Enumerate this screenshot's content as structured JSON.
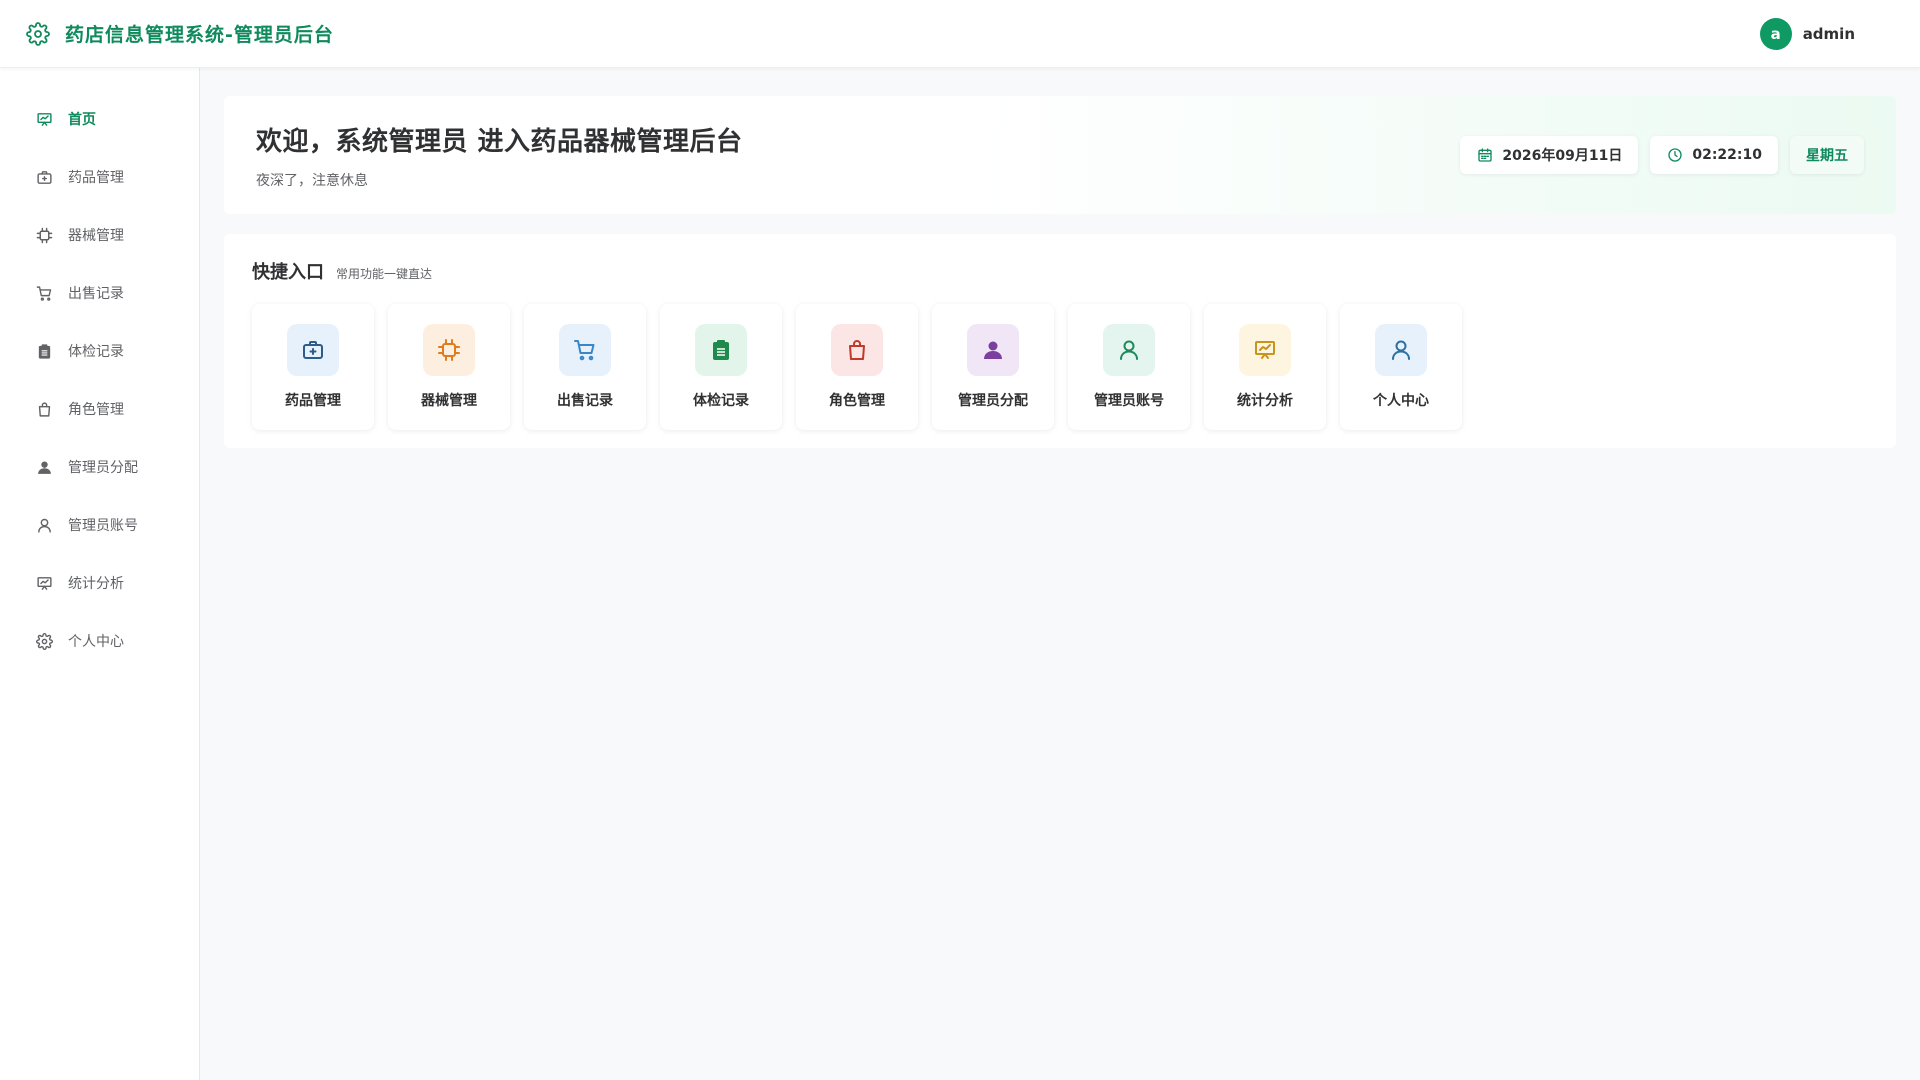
{
  "header": {
    "app_title": "药店信息管理系统-管理员后台",
    "user": {
      "avatar_letter": "a",
      "name": "admin"
    },
    "brand_color": "#0f8a5c"
  },
  "sidebar": {
    "items": [
      {
        "label": "首页",
        "icon": "presentation-chart-icon",
        "active": true
      },
      {
        "label": "药品管理",
        "icon": "medical-kit-icon"
      },
      {
        "label": "器械管理",
        "icon": "chip-icon"
      },
      {
        "label": "出售记录",
        "icon": "shopping-cart-icon"
      },
      {
        "label": "体检记录",
        "icon": "clipboard-icon"
      },
      {
        "label": "角色管理",
        "icon": "shopping-bag-icon"
      },
      {
        "label": "管理员分配",
        "icon": "user-filled-icon"
      },
      {
        "label": "管理员账号",
        "icon": "user-outline-icon"
      },
      {
        "label": "统计分析",
        "icon": "presentation-chart-icon"
      },
      {
        "label": "个人中心",
        "icon": "gear-icon"
      }
    ]
  },
  "banner": {
    "title": "欢迎，系统管理员 进入药品器械管理后台",
    "subtitle": "夜深了，注意休息",
    "date": "2026年09月11日",
    "time": "02:22:10",
    "weekday": "星期五"
  },
  "quick_access": {
    "title": "快捷入口",
    "subtitle": "常用功能一键直达",
    "cards": [
      {
        "label": "药品管理",
        "icon": "medical-kit-icon",
        "color": "#2d5b8a",
        "bg": "#e6f1fb"
      },
      {
        "label": "器械管理",
        "icon": "chip-icon",
        "color": "#e07b1e",
        "bg": "#fdefe0"
      },
      {
        "label": "出售记录",
        "icon": "shopping-cart-icon",
        "color": "#3a87c8",
        "bg": "#e6f1fb"
      },
      {
        "label": "体检记录",
        "icon": "clipboard-icon",
        "color": "#1e8a4c",
        "bg": "#e3f5ea"
      },
      {
        "label": "角色管理",
        "icon": "shopping-bag-icon",
        "color": "#c0392b",
        "bg": "#fbe5e5"
      },
      {
        "label": "管理员分配",
        "icon": "user-filled-icon",
        "color": "#7b3fa0",
        "bg": "#f0e6f5"
      },
      {
        "label": "管理员账号",
        "icon": "user-outline-icon",
        "color": "#1e8a5c",
        "bg": "#e3f5ee"
      },
      {
        "label": "统计分析",
        "icon": "presentation-chart-icon",
        "color": "#c8941e",
        "bg": "#fdf5e0"
      },
      {
        "label": "个人中心",
        "icon": "user-outline-icon",
        "color": "#2d6fa0",
        "bg": "#e6f1fb"
      }
    ]
  }
}
